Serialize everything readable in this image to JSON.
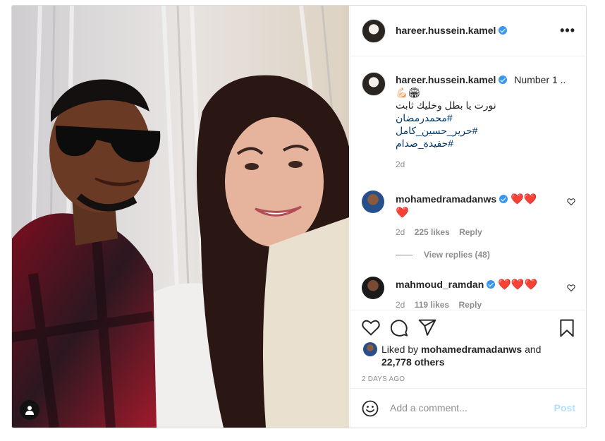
{
  "post": {
    "username": "hareer.hussein.kamel",
    "more_label": "•••",
    "caption": {
      "title": "Number 1 ..",
      "emoji": "💪🏻🏟",
      "line1": "نورت يا بطل وخليك ثابت",
      "hashtags": [
        "#محمدرمضان",
        "#حرير_حسين_كامل",
        "#حفيدة_صدام"
      ],
      "time": "2d"
    },
    "comments": [
      {
        "username": "mohamedramadanws",
        "hearts": "❤️❤️",
        "hearts_line2": "❤️",
        "time": "2d",
        "likes": "225 likes",
        "reply": "Reply",
        "view_replies": "View replies (48)"
      },
      {
        "username": "mahmoud_ramdan",
        "hearts": "❤️❤️❤️",
        "time": "2d",
        "likes": "119 likes",
        "reply": "Reply"
      }
    ],
    "liked_by_prefix": "Liked by",
    "liked_by_user": "mohamedramadanws",
    "liked_by_and": "and",
    "liked_by_others": "22,778 others",
    "timestamp": "2 DAYS AGO",
    "comment_placeholder": "Add a comment...",
    "post_label": "Post"
  },
  "colors": {
    "verified": "#3897f0",
    "heart": "#ed4956",
    "post_button": "#b2dffc",
    "hashtag": "#00376b"
  },
  "icons": [
    "verified-icon",
    "more-icon",
    "heart-icon",
    "comment-icon",
    "share-icon",
    "bookmark-icon",
    "emoji-icon",
    "user-tag-icon"
  ]
}
